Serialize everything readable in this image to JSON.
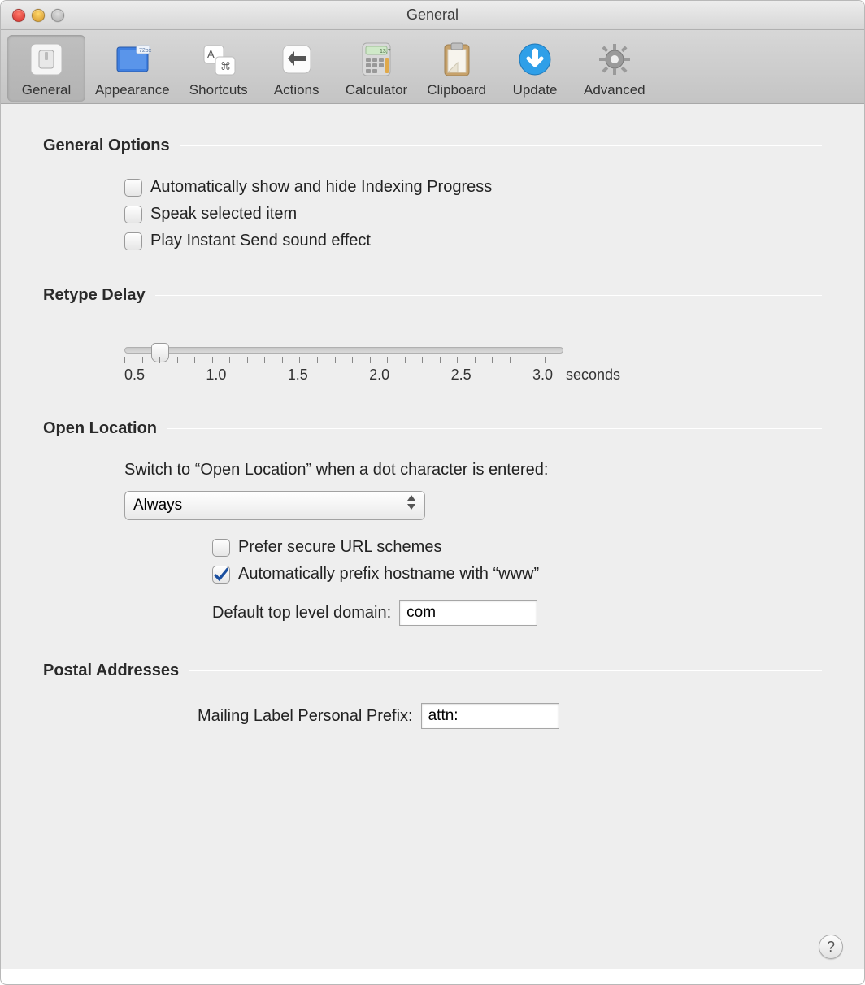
{
  "window": {
    "title": "General"
  },
  "toolbar": {
    "items": [
      {
        "label": "General"
      },
      {
        "label": "Appearance"
      },
      {
        "label": "Shortcuts"
      },
      {
        "label": "Actions"
      },
      {
        "label": "Calculator"
      },
      {
        "label": "Clipboard"
      },
      {
        "label": "Update"
      },
      {
        "label": "Advanced"
      }
    ]
  },
  "sections": {
    "general_options": {
      "title": "General Options",
      "checks": [
        "Automatically show and hide Indexing Progress",
        "Speak selected item",
        "Play Instant Send sound effect"
      ]
    },
    "retype_delay": {
      "title": "Retype Delay",
      "ticks": [
        "0.5",
        "1.0",
        "1.5",
        "2.0",
        "2.5",
        "3.0"
      ],
      "unit": "seconds"
    },
    "open_location": {
      "title": "Open Location",
      "desc": "Switch to “Open Location” when a dot character is entered:",
      "select_value": "Always",
      "check_prefer": "Prefer secure URL schemes",
      "check_www": "Automatically prefix hostname with “www”",
      "tld_label": "Default top level domain:",
      "tld_value": "com"
    },
    "postal": {
      "title": "Postal Addresses",
      "prefix_label": "Mailing Label Personal Prefix:",
      "prefix_value": "attn:"
    }
  },
  "help": "?"
}
